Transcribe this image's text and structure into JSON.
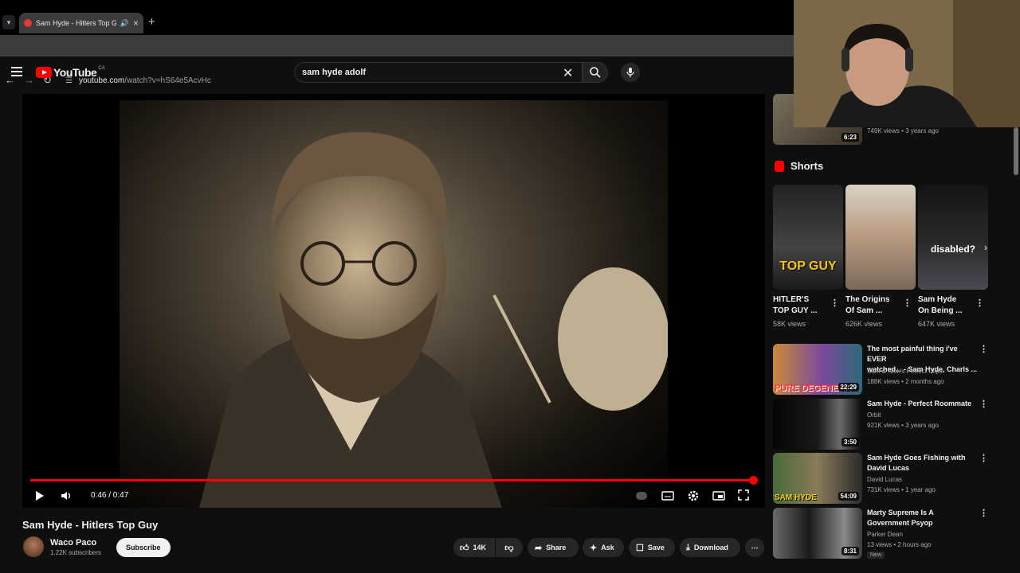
{
  "browser": {
    "tab_title": "Sam Hyde - Hitlers Top Guy",
    "url_host": "youtube.com",
    "url_path": "/watch?v=hS64e5AcvHc"
  },
  "header": {
    "logo_text": "YouTube",
    "country": "CA",
    "search_value": "sam hyde adolf"
  },
  "player": {
    "time": "0:46 / 0:47",
    "progress_fraction": 0.98
  },
  "video": {
    "title": "Sam Hyde - Hitlers Top Guy",
    "channel": "Waco Paco",
    "subscribers": "1.22K subscribers",
    "subscribe_label": "Subscribe",
    "likes": "14K",
    "share_label": "Share",
    "ask_label": "Ask",
    "save_label": "Save",
    "download_label": "Download"
  },
  "sidebar": {
    "top_item": {
      "duration": "6:23",
      "meta": "749K views • 3 years ago"
    },
    "shorts_heading": "Shorts",
    "shorts": [
      {
        "title_line1": "HITLER'S",
        "title_line2": "TOP GUY ...",
        "views": "58K views",
        "overlay": "TOP GUY"
      },
      {
        "title_line1": "The Origins",
        "title_line2": "Of Sam ...",
        "views": "626K views",
        "overlay": ""
      },
      {
        "title_line1": "Sam Hyde",
        "title_line2": "On Being ...",
        "views": "647K views",
        "overlay": "disabled?"
      }
    ],
    "recs": [
      {
        "title_line1": "The most painful thing i've EVER",
        "title_line2": "watched... - Sam Hyde, Charls ...",
        "channel": "Sam & Nick's Perfect Clips",
        "meta": "188K views • 2 months ago",
        "duration": "22:29",
        "overlay": "PURE DEGENERA"
      },
      {
        "title_line1": "Sam Hyde - Perfect Roommate",
        "title_line2": "",
        "channel": "Orbit",
        "meta": "921K views • 3 years ago",
        "duration": "3:50",
        "overlay": ""
      },
      {
        "title_line1": "Sam Hyde Goes Fishing with",
        "title_line2": "David Lucas",
        "channel": "David Lucas",
        "meta": "731K views • 1 year ago",
        "duration": "54:09",
        "overlay": "SAM HYDE"
      },
      {
        "title_line1": "Marty Supreme Is A",
        "title_line2": "Government Psyop",
        "channel": "Parker Dean",
        "meta": "13 views • 2 hours ago",
        "duration": "8:31",
        "overlay": ""
      }
    ],
    "new_badge": "New"
  }
}
